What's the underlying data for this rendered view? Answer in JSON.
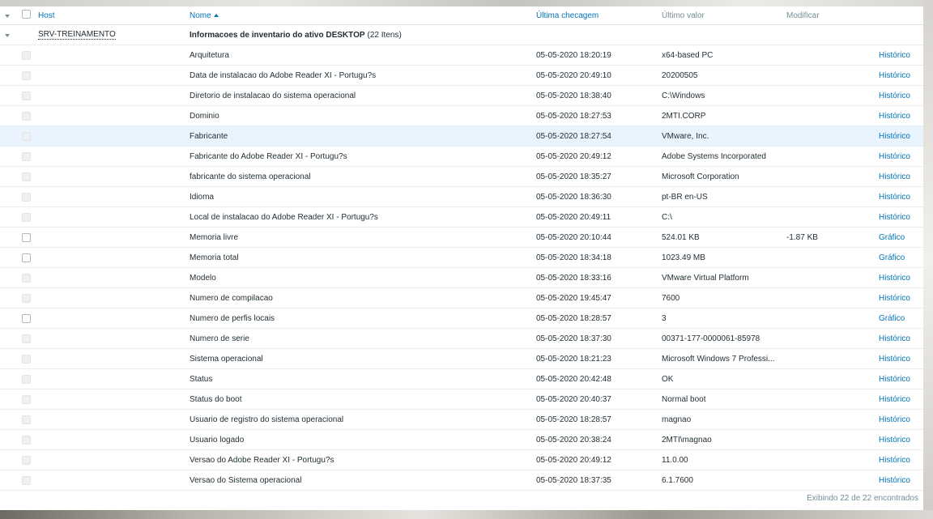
{
  "header": {
    "host": "Host",
    "name": "Nome",
    "last_check": "Última checagem",
    "last_value": "Último valor",
    "change": "Modificar"
  },
  "group": {
    "host": "SRV-TREINAMENTO",
    "title": "Informacoes de inventario do ativo DESKTOP",
    "count": "(22 Itens)"
  },
  "items": [
    {
      "name": "Arquitetura",
      "time": "05-05-2020 18:20:19",
      "value": "x64-based PC",
      "change": "",
      "action": "Histórico"
    },
    {
      "name": "Data de instalacao do Adobe Reader XI - Portugu?s",
      "time": "05-05-2020 20:49:10",
      "value": "20200505",
      "change": "",
      "action": "Histórico"
    },
    {
      "name": "Diretorio de instalacao do sistema operacional",
      "time": "05-05-2020 18:38:40",
      "value": "C:\\Windows",
      "change": "",
      "action": "Histórico"
    },
    {
      "name": "Dominio",
      "time": "05-05-2020 18:27:53",
      "value": "2MTI.CORP",
      "change": "",
      "action": "Histórico"
    },
    {
      "name": "Fabricante",
      "time": "05-05-2020 18:27:54",
      "value": "VMware, Inc.",
      "change": "",
      "action": "Histórico"
    },
    {
      "name": "Fabricante do Adobe Reader XI - Portugu?s",
      "time": "05-05-2020 20:49:12",
      "value": "Adobe Systems Incorporated",
      "change": "",
      "action": "Histórico"
    },
    {
      "name": "fabricante do sistema operacional",
      "time": "05-05-2020 18:35:27",
      "value": "Microsoft Corporation",
      "change": "",
      "action": "Histórico"
    },
    {
      "name": "Idioma",
      "time": "05-05-2020 18:36:30",
      "value": "pt-BR en-US",
      "change": "",
      "action": "Histórico"
    },
    {
      "name": "Local de instalacao do Adobe Reader XI - Portugu?s",
      "time": "05-05-2020 20:49:11",
      "value": "C:\\",
      "change": "",
      "action": "Histórico"
    },
    {
      "name": "Memoria livre",
      "time": "05-05-2020 20:10:44",
      "value": "524.01 KB",
      "change": "-1.87 KB",
      "action": "Gráfico"
    },
    {
      "name": "Memoria total",
      "time": "05-05-2020 18:34:18",
      "value": "1023.49 MB",
      "change": "",
      "action": "Gráfico"
    },
    {
      "name": "Modelo",
      "time": "05-05-2020 18:33:16",
      "value": "VMware Virtual Platform",
      "change": "",
      "action": "Histórico"
    },
    {
      "name": "Numero de compilacao",
      "time": "05-05-2020 19:45:47",
      "value": "7600",
      "change": "",
      "action": "Histórico"
    },
    {
      "name": "Numero de perfis locais",
      "time": "05-05-2020 18:28:57",
      "value": "3",
      "change": "",
      "action": "Gráfico"
    },
    {
      "name": "Numero de serie",
      "time": "05-05-2020 18:37:30",
      "value": "00371-177-0000061-85978",
      "change": "",
      "action": "Histórico"
    },
    {
      "name": "Sistema operacional",
      "time": "05-05-2020 18:21:23",
      "value": "Microsoft Windows 7 Professi...",
      "change": "",
      "action": "Histórico"
    },
    {
      "name": "Status",
      "time": "05-05-2020 20:42:48",
      "value": "OK",
      "change": "",
      "action": "Histórico"
    },
    {
      "name": "Status do boot",
      "time": "05-05-2020 20:40:37",
      "value": "Normal boot",
      "change": "",
      "action": "Histórico"
    },
    {
      "name": "Usuario de registro do sistema operacional",
      "time": "05-05-2020 18:28:57",
      "value": "magnao",
      "change": "",
      "action": "Histórico"
    },
    {
      "name": "Usuario logado",
      "time": "05-05-2020 20:38:24",
      "value": "2MTI\\magnao",
      "change": "",
      "action": "Histórico"
    },
    {
      "name": "Versao do Adobe Reader XI - Portugu?s",
      "time": "05-05-2020 20:49:12",
      "value": "11.0.00",
      "change": "",
      "action": "Histórico"
    },
    {
      "name": "Versao do Sistema operacional",
      "time": "05-05-2020 18:37:35",
      "value": "6.1.7600",
      "change": "",
      "action": "Histórico"
    }
  ],
  "footer": "Exibindo 22 de 22 encontrados",
  "colors": {
    "link": "#0275b8",
    "header_text": "#768d99",
    "highlight": "#e9f4fe"
  },
  "icons": {
    "collapse": "caret-down-icon",
    "sort": "sort-ascending-icon"
  }
}
